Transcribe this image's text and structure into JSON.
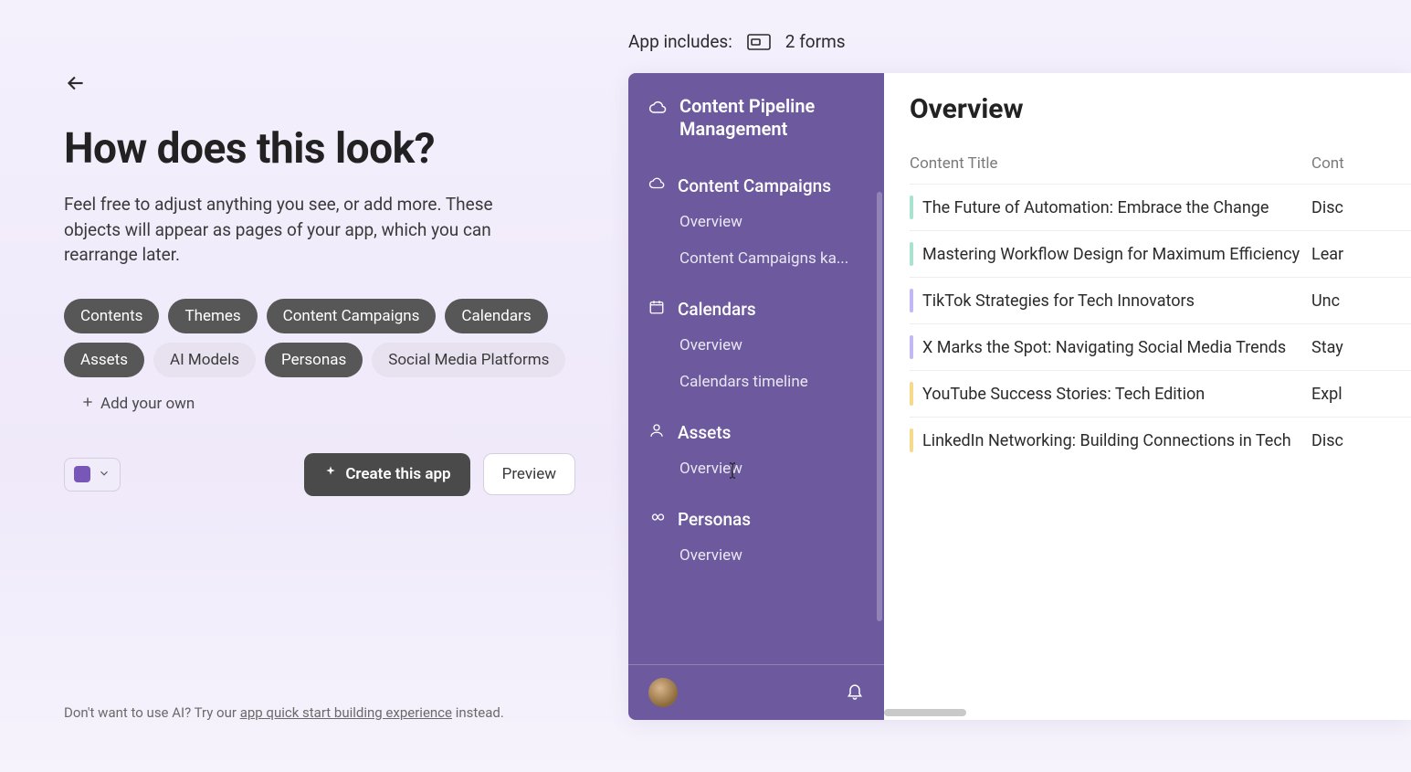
{
  "left": {
    "title": "How does this look?",
    "description": "Feel free to adjust anything you see, or add more. These objects will appear as pages of your app, which you can rearrange later.",
    "chips": [
      {
        "label": "Contents",
        "selected": true
      },
      {
        "label": "Themes",
        "selected": true
      },
      {
        "label": "Content Campaigns",
        "selected": true
      },
      {
        "label": "Calendars",
        "selected": true
      },
      {
        "label": "Assets",
        "selected": true
      },
      {
        "label": "AI Models",
        "selected": false
      },
      {
        "label": "Personas",
        "selected": true
      },
      {
        "label": "Social Media Platforms",
        "selected": false
      }
    ],
    "add_chip_label": "Add your own",
    "accent_color": "#7857b8",
    "create_button": "Create this app",
    "preview_button": "Preview"
  },
  "includes": {
    "label": "App includes:",
    "forms_label": "2 forms"
  },
  "sidebar": {
    "app_title": "Content Pipeline Management",
    "sections": [
      {
        "icon": "cloud-icon",
        "label": "Content Campaigns",
        "items": [
          "Overview",
          "Content Campaigns ka..."
        ]
      },
      {
        "icon": "calendar-icon",
        "label": "Calendars",
        "items": [
          "Overview",
          "Calendars timeline"
        ]
      },
      {
        "icon": "person-icon",
        "label": "Assets",
        "items": [
          "Overview"
        ]
      },
      {
        "icon": "infinity-icon",
        "label": "Personas",
        "items": [
          "Overview"
        ]
      }
    ]
  },
  "main": {
    "title": "Overview",
    "columns": {
      "title": "Content Title",
      "desc": "Cont"
    },
    "rows": [
      {
        "marker": "#a7e3cf",
        "title": "The Future of Automation: Embrace the Change",
        "desc": "Disc"
      },
      {
        "marker": "#a7e3cf",
        "title": "Mastering Workflow Design for Maximum Efficiency",
        "desc": "Lear"
      },
      {
        "marker": "#c4b7f6",
        "title": "TikTok Strategies for Tech Innovators",
        "desc": "Unc"
      },
      {
        "marker": "#c4b7f6",
        "title": "X Marks the Spot: Navigating Social Media Trends",
        "desc": "Stay"
      },
      {
        "marker": "#f6d98a",
        "title": "YouTube Success Stories: Tech Edition",
        "desc": "Expl"
      },
      {
        "marker": "#f6d98a",
        "title": "LinkedIn Networking: Building Connections in Tech",
        "desc": "Disc"
      }
    ]
  },
  "footer": {
    "pre": "Don't want to use AI? Try our ",
    "link": "app quick start building experience",
    "post": " instead."
  }
}
